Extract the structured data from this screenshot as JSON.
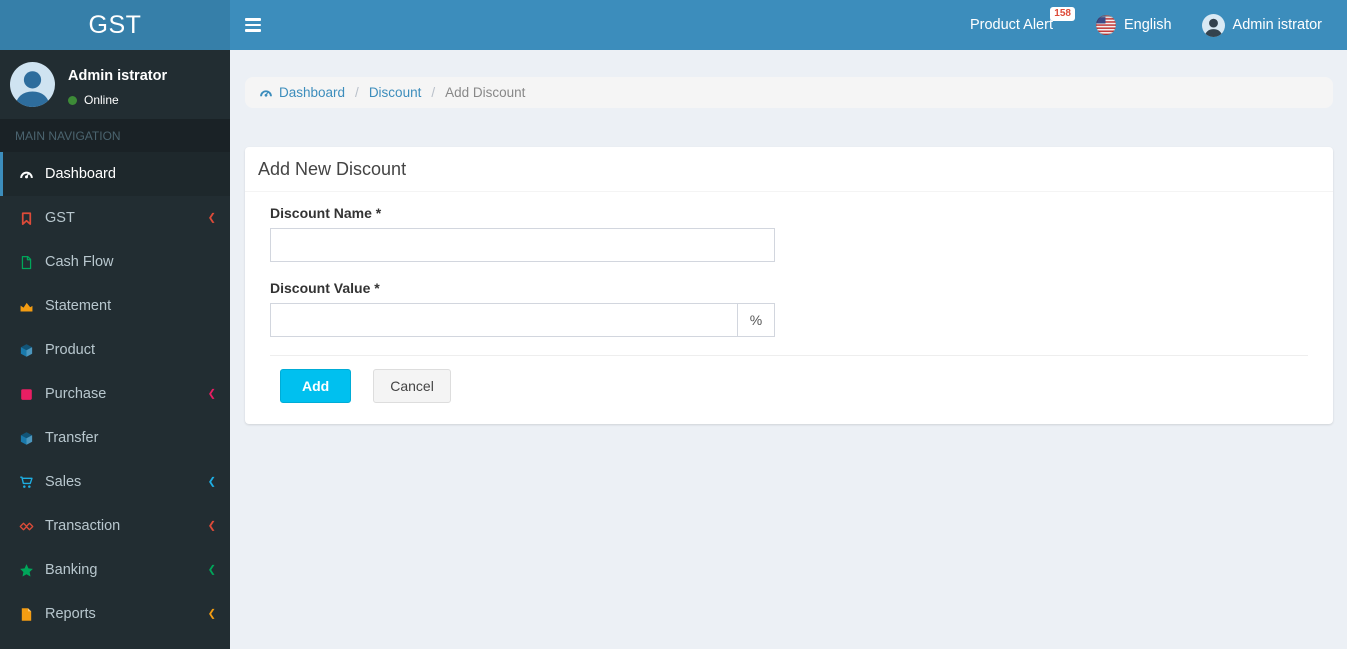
{
  "app": {
    "logo_text": "GST",
    "colors": {
      "navbar_bg": "#3c8dbc",
      "logo_bg": "#367fa9",
      "sidebar_bg": "#222d32",
      "sidebar_active_bg": "#1e282c",
      "accent": "#3c8dbc",
      "content_bg": "#ecf0f5",
      "add_button_bg": "#00c0ef",
      "badge_text": "#dd4b39",
      "online_dot": "#3d8b37"
    }
  },
  "icons": {
    "chevron_left": "❮"
  },
  "navbar": {
    "product_alert_label": "Product Alert",
    "product_alert_badge": "158",
    "language_label": "English",
    "user_label": "Admin istrator"
  },
  "sidebar": {
    "user": {
      "name": "Admin istrator",
      "status": "Online"
    },
    "nav_header": "MAIN NAVIGATION",
    "items": [
      {
        "label": "Dashboard",
        "icon": "dashboard-icon",
        "color": "#ffffff",
        "active": true,
        "has_submenu": false
      },
      {
        "label": "GST",
        "icon": "bookmark-icon",
        "color": "#dd4b39",
        "active": false,
        "has_submenu": true
      },
      {
        "label": "Cash Flow",
        "icon": "file-outline-icon",
        "color": "#00a65a",
        "active": false,
        "has_submenu": false
      },
      {
        "label": "Statement",
        "icon": "area-chart-icon",
        "color": "#f39c12",
        "active": false,
        "has_submenu": false
      },
      {
        "label": "Product",
        "icon": "cube-icon",
        "color": "#1a79ab",
        "active": false,
        "has_submenu": false
      },
      {
        "label": "Purchase",
        "icon": "square-icon",
        "color": "#e91e63",
        "active": false,
        "has_submenu": true
      },
      {
        "label": "Transfer",
        "icon": "cube-icon",
        "color": "#1a79ab",
        "active": false,
        "has_submenu": false
      },
      {
        "label": "Sales",
        "icon": "cart-icon",
        "color": "#1eaee3",
        "active": false,
        "has_submenu": true
      },
      {
        "label": "Transaction",
        "icon": "gg-diamonds-icon",
        "color": "#dd4b39",
        "active": false,
        "has_submenu": true
      },
      {
        "label": "Banking",
        "icon": "star-icon",
        "color": "#00a65a",
        "active": false,
        "has_submenu": true
      },
      {
        "label": "Reports",
        "icon": "file-icon",
        "color": "#f39c12",
        "active": false,
        "has_submenu": true
      }
    ]
  },
  "breadcrumb": {
    "separator": "/",
    "items": [
      {
        "label": "Dashboard",
        "icon": "dashboard-icon",
        "link": true
      },
      {
        "label": "Discount",
        "link": true
      },
      {
        "label": "Add Discount",
        "link": false,
        "current": true
      }
    ]
  },
  "content": {
    "card_title": "Add New Discount",
    "form": {
      "discount_name": {
        "label": "Discount Name *",
        "value": "",
        "placeholder": ""
      },
      "discount_value": {
        "label": "Discount Value *",
        "value": "",
        "placeholder": "",
        "addon": "%"
      }
    },
    "buttons": {
      "add": "Add",
      "cancel": "Cancel"
    }
  }
}
